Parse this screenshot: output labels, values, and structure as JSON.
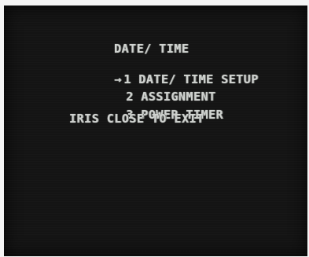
{
  "menu": {
    "title": "DATE/ TIME",
    "cursor": "→",
    "items": [
      {
        "label": "1 DATE/ TIME SETUP"
      },
      {
        "label": "2 ASSIGNMENT"
      },
      {
        "label": "3 POWER TIMER"
      }
    ],
    "footer": "IRIS CLOSE TO EXIT"
  },
  "colors": {
    "screen": "#141414",
    "text": "#cfd2cf",
    "frame": "#f4f4f4"
  }
}
